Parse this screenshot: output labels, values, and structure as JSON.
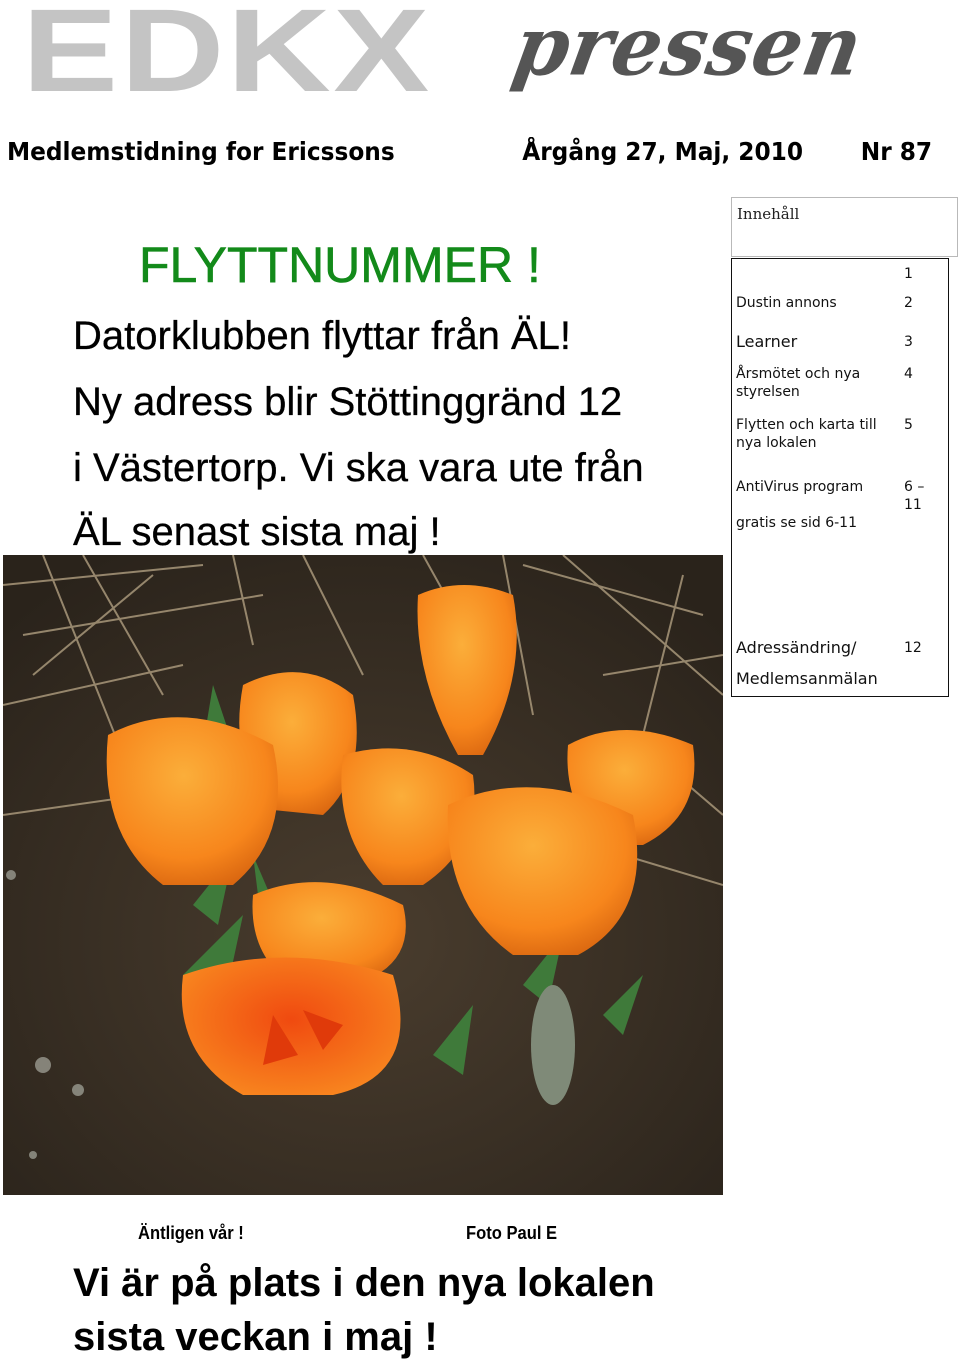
{
  "masthead": {
    "logo_main": "EDKX",
    "logo_script": "pressen"
  },
  "subheader": {
    "publication": "Medlemstidning for Ericssons",
    "volume_date": "Årgång 27,  Maj, 2010",
    "issue": "Nr 87"
  },
  "headline": "FLYTTNUMMER !",
  "body_lines": [
    "Datorklubben flyttar från ÄL!",
    "Ny adress blir Stöttinggränd 12",
    "i Västertorp. Vi ska vara ute från",
    "ÄL senast sista maj !"
  ],
  "toc": {
    "title": "Innehåll",
    "entries": [
      {
        "label": "",
        "page": "1"
      },
      {
        "label": "Dustin annons",
        "page": "2"
      },
      {
        "label": "Learner",
        "page": "3"
      },
      {
        "label": "Årsmötet och nya styrelsen",
        "page": "4"
      },
      {
        "label": "Flytten och karta till  nya lokalen",
        "page": "5"
      },
      {
        "label": "AntiVirus program",
        "page": "6 – 11"
      },
      {
        "label": "gratis  se sid 6-11",
        "page": ""
      },
      {
        "label": "Adressändring/",
        "page": "12"
      },
      {
        "label": "Medlemsanmälan",
        "page": ""
      }
    ]
  },
  "photo": {
    "subject": "orange crocus flowers",
    "colors": {
      "petal": "#f7861c",
      "petal_light": "#fbae3a",
      "soil": "#3b3226",
      "grass": "#9b8a6a",
      "leaf": "#3f7a3a"
    }
  },
  "captions": {
    "left": "Äntligen vår !",
    "right": "Foto Paul E"
  },
  "closing_lines": [
    "Vi är på plats i den nya lokalen",
    "sista veckan i maj !"
  ],
  "colors": {
    "headline_green": "#138a1a",
    "logo_gray": "#c4c4c4",
    "script_gray": "#555555"
  }
}
